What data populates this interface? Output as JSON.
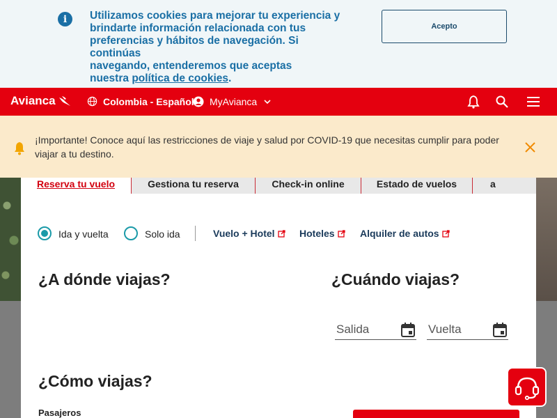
{
  "cookie_banner": {
    "line1": "Utilizamos cookies para mejorar tu experiencia y",
    "line2": "brindarte información relacionada con tus",
    "line3": "preferencias y hábitos de navegación. Si continúas",
    "line4": "navegando, entenderemos que aceptas",
    "line5_prefix": "nuestra ",
    "link_text": "política de cookies",
    "line5_suffix": ".",
    "accept_label": "Acepto",
    "icon": "info-icon"
  },
  "header": {
    "brand": "Avianca",
    "country": "Colombia - Español",
    "account": "MyAvianca",
    "icons": [
      "globe-icon",
      "user-icon",
      "chevron-down-icon",
      "bell-icon",
      "search-icon",
      "menu-icon"
    ]
  },
  "covid_banner": {
    "message": "¡Importante! Conoce aquí las restricciones de viaje y salud por COVID-19 que necesitas cumplir para poder viajar a tu destino.",
    "icon": "bell-icon"
  },
  "tabs": [
    {
      "label": "Reserva tu vuelo",
      "active": true
    },
    {
      "label": "Gestiona tu reserva",
      "active": false
    },
    {
      "label": "Check-in online",
      "active": false
    },
    {
      "label": "Estado de vuelos",
      "active": false
    },
    {
      "label": "Ascenso a",
      "active": false
    }
  ],
  "trip_type": {
    "round_trip": "Ida y vuelta",
    "one_way": "Solo ida",
    "selected": "Ida y vuelta"
  },
  "links": {
    "flight_hotel": "Vuelo + Hotel",
    "hotels": "Hoteles",
    "car_rental": "Alquiler de autos"
  },
  "sections": {
    "where": "¿A dónde viajas?",
    "when": "¿Cuándo viajas?",
    "how": "¿Cómo viajas?",
    "passengers": "Pasajeros"
  },
  "dates": {
    "departure_placeholder": "Salida",
    "return_placeholder": "Vuelta"
  },
  "colors": {
    "brand_red": "#e4000f",
    "cookie_blue": "#1a6fa5",
    "radio_teal": "#1a9aa8",
    "covid_bg": "#fbeacb"
  }
}
